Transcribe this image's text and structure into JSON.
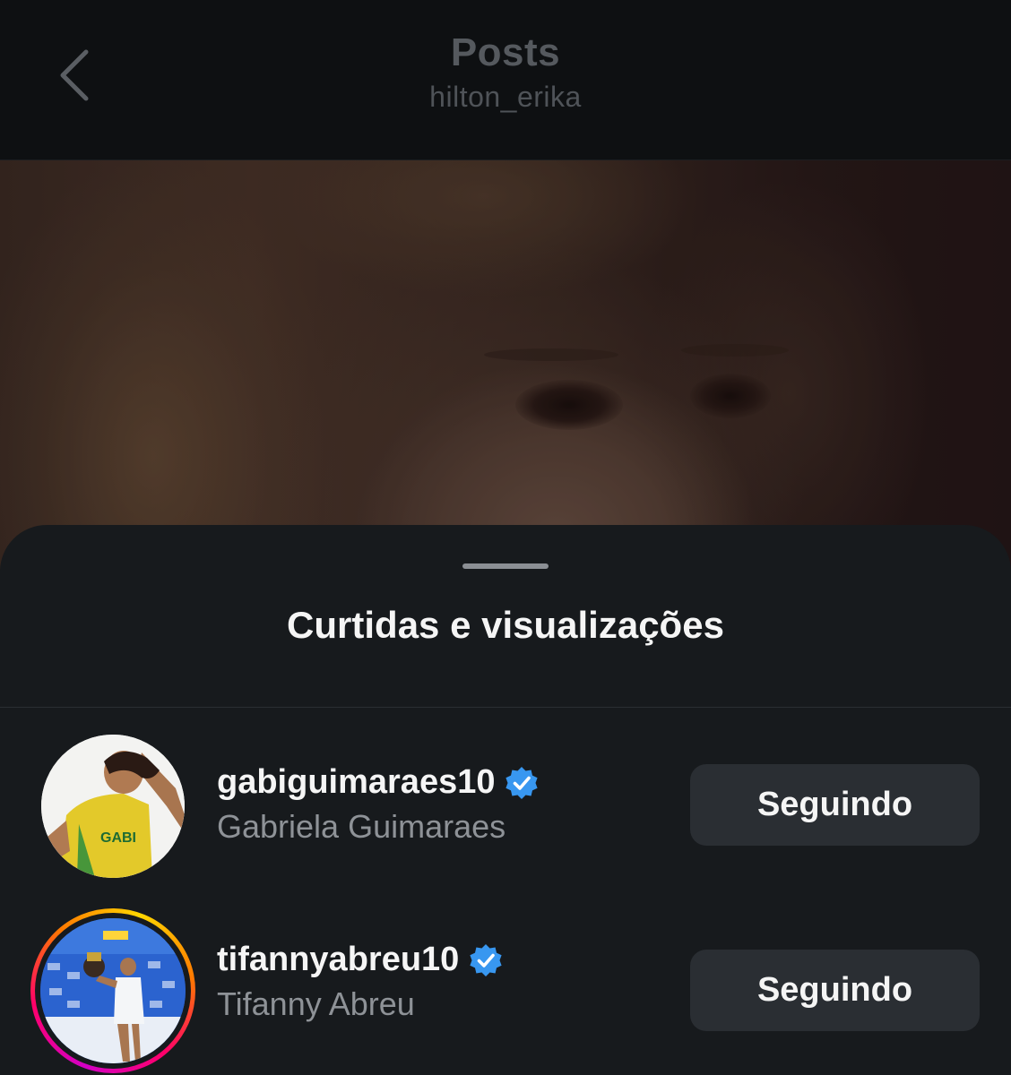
{
  "header": {
    "title": "Posts",
    "subtitle": "hilton_erika",
    "back_icon": "chevron-left-icon"
  },
  "post": {
    "media_description_icon": "photo"
  },
  "sheet": {
    "title": "Curtidas e visualizações"
  },
  "likers": [
    {
      "username": "gabiguimaraes10",
      "full_name": "Gabriela Guimaraes",
      "verified": true,
      "story_ring": false,
      "button_label": "Seguindo",
      "jersey_text": "GABI"
    },
    {
      "username": "tifannyabreu10",
      "full_name": "Tifanny Abreu",
      "verified": true,
      "story_ring": true,
      "button_label": "Seguindo"
    }
  ],
  "colors": {
    "verified_badge": "#3897f0",
    "button_bg": "#2a2e33",
    "sheet_bg": "#171a1d"
  }
}
